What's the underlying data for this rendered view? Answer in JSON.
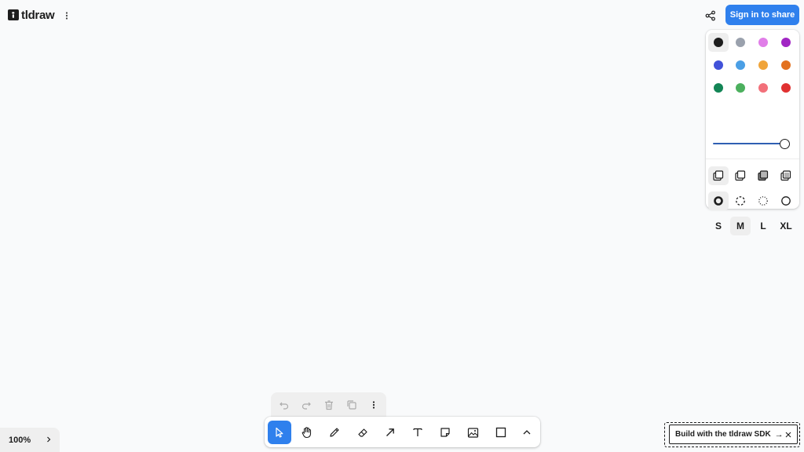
{
  "app": {
    "logo_text": "tldraw",
    "menu_icon": "dots-vertical-icon"
  },
  "header": {
    "share_icon": "share-nodes-icon",
    "signin_label": "Sign in to share",
    "accent": "#2f80ed"
  },
  "style_panel": {
    "colors": [
      {
        "name": "black",
        "hex": "#1d1d1d",
        "selected": true
      },
      {
        "name": "grey",
        "hex": "#9aa1ad",
        "selected": false
      },
      {
        "name": "light-violet",
        "hex": "#e07ee8",
        "selected": false
      },
      {
        "name": "violet",
        "hex": "#a126c4",
        "selected": false
      },
      {
        "name": "blue",
        "hex": "#4152d9",
        "selected": false
      },
      {
        "name": "light-blue",
        "hex": "#4b9fe5",
        "selected": false
      },
      {
        "name": "yellow",
        "hex": "#f0a43a",
        "selected": false
      },
      {
        "name": "orange",
        "hex": "#e3711f",
        "selected": false
      },
      {
        "name": "green",
        "hex": "#138556",
        "selected": false
      },
      {
        "name": "light-green",
        "hex": "#4cb05e",
        "selected": false
      },
      {
        "name": "light-red",
        "hex": "#f2707a",
        "selected": false
      },
      {
        "name": "red",
        "hex": "#e03131",
        "selected": false
      }
    ],
    "opacity": 1.0,
    "fills": [
      {
        "name": "fill-none-icon",
        "selected": true
      },
      {
        "name": "fill-semi-icon",
        "selected": false
      },
      {
        "name": "fill-solid-icon",
        "selected": false
      },
      {
        "name": "fill-pattern-icon",
        "selected": false
      }
    ],
    "dashes": [
      {
        "name": "dash-draw-icon",
        "selected": true
      },
      {
        "name": "dash-dashed-icon",
        "selected": false
      },
      {
        "name": "dash-dotted-icon",
        "selected": false
      },
      {
        "name": "dash-solid-icon",
        "selected": false
      }
    ],
    "sizes": [
      {
        "label": "S",
        "selected": false
      },
      {
        "label": "M",
        "selected": true
      },
      {
        "label": "L",
        "selected": false
      },
      {
        "label": "XL",
        "selected": false
      }
    ]
  },
  "zoom": {
    "label": "100%"
  },
  "quick_actions": [
    "undo-icon",
    "redo-icon",
    "trash-icon",
    "duplicate-icon",
    "more-icon"
  ],
  "toolbar": {
    "tools": [
      {
        "name": "select-tool",
        "active": true
      },
      {
        "name": "hand-tool",
        "active": false
      },
      {
        "name": "draw-tool",
        "active": false
      },
      {
        "name": "eraser-tool",
        "active": false
      },
      {
        "name": "arrow-tool",
        "active": false
      },
      {
        "name": "text-tool",
        "active": false
      },
      {
        "name": "note-tool",
        "active": false
      },
      {
        "name": "media-tool",
        "active": false
      },
      {
        "name": "rectangle-tool",
        "active": false
      },
      {
        "name": "more-tools-toggle",
        "active": false
      }
    ]
  },
  "sdk_banner": {
    "text": "Build with the tldraw SDK",
    "arrow": "→"
  }
}
